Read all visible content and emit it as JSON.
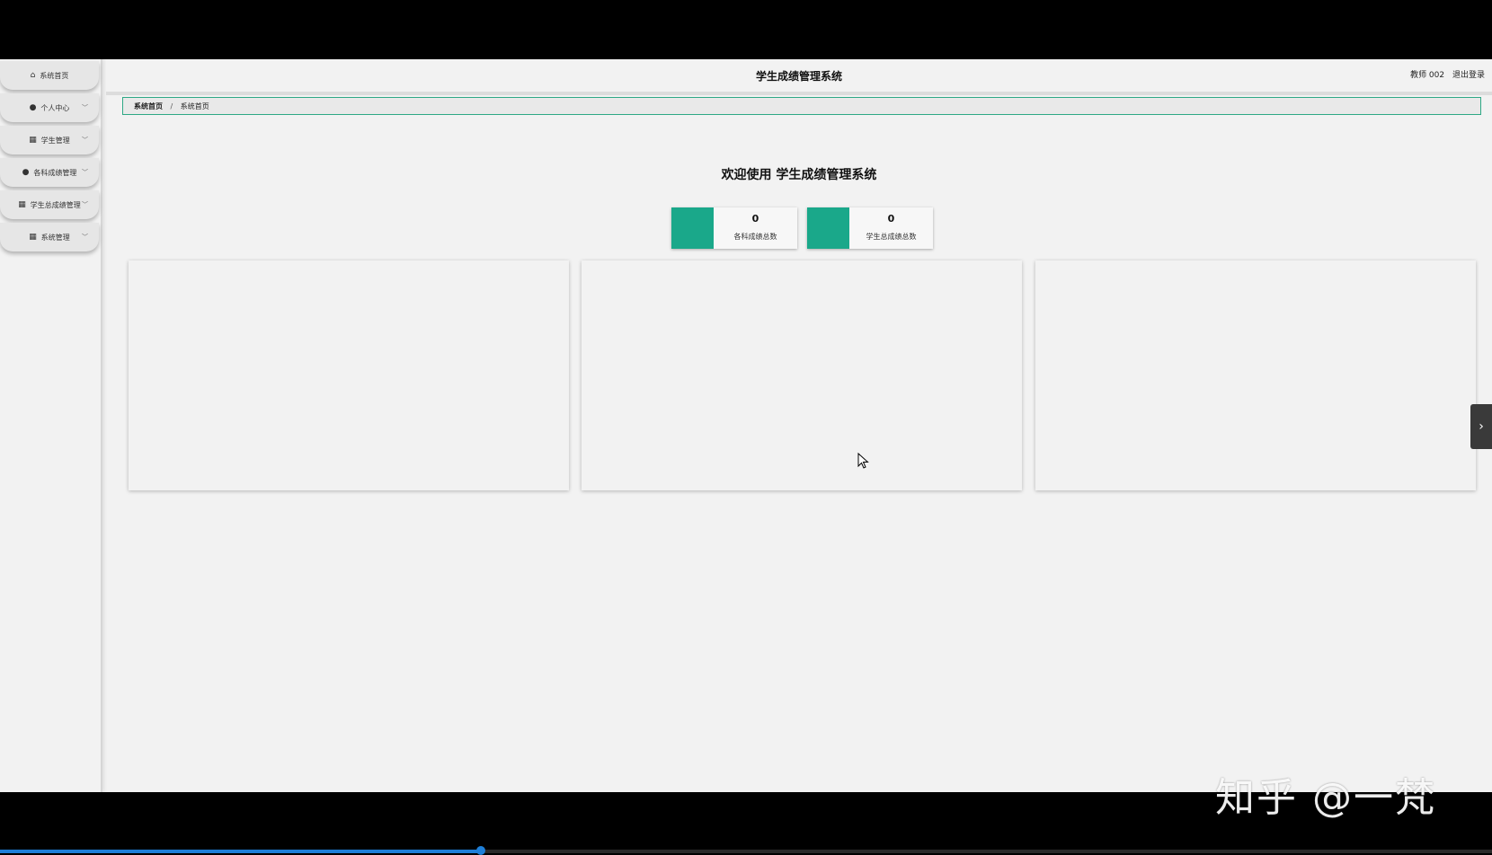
{
  "header": {
    "title": "学生成绩管理系统",
    "user": "教师 002",
    "logout": "退出登录"
  },
  "sidebar": {
    "items": [
      {
        "label": "系统首页",
        "icon": "home-icon",
        "has_submenu": false
      },
      {
        "label": "个人中心",
        "icon": "user-icon",
        "has_submenu": true
      },
      {
        "label": "学生管理",
        "icon": "grid-icon",
        "has_submenu": true
      },
      {
        "label": "各科成绩管理",
        "icon": "user-icon",
        "has_submenu": true
      },
      {
        "label": "学生总成绩管理",
        "icon": "grid-icon",
        "has_submenu": true
      },
      {
        "label": "系统管理",
        "icon": "grid-icon",
        "has_submenu": true
      }
    ]
  },
  "breadcrumb": {
    "root": "系统首页",
    "separator": "/",
    "current": "系统首页"
  },
  "welcome": "欢迎使用 学生成绩管理系统",
  "stats": [
    {
      "value": "0",
      "label": "各科成绩总数"
    },
    {
      "value": "0",
      "label": "学生总成绩总数"
    }
  ],
  "watermark": "知乎 @一梵",
  "colors": {
    "accent": "#1aa88a",
    "border_accent": "#2ea885",
    "progress": "#1e7fd8"
  },
  "video_progress": 0.322
}
